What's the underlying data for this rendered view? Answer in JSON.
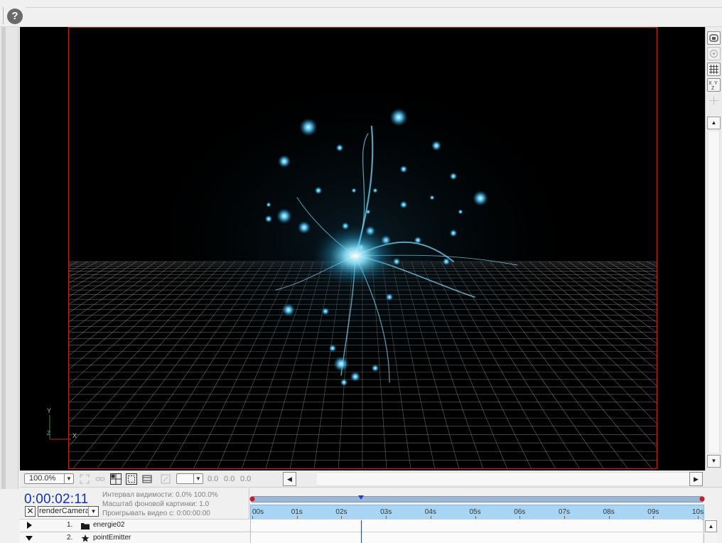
{
  "toolbar": {
    "help_label": "?"
  },
  "viewer": {
    "axis_y": "Y",
    "axis_z": "Z",
    "axis_x": "X",
    "colors": {
      "frame": "#cc1b1b",
      "grid": "#8a8a8a",
      "particles": "#5fd3ff"
    }
  },
  "viewer_bar": {
    "zoom_value": "100.0%",
    "coords": [
      "0.0",
      "0.0",
      "0.0"
    ],
    "scroll_left": "◀",
    "scroll_right": "▶"
  },
  "right_tools": {
    "icons": [
      "camera-orbit-icon",
      "target-icon",
      "grid-toggle-icon",
      "xyz-axis-icon",
      "light-icon"
    ],
    "scroll_up": "▲",
    "scroll_down": "▼"
  },
  "timeline": {
    "timecode": "0:00:02:11",
    "visibility_interval": "Интервал видимости: 0.0%  100.0%",
    "bg_scale": "Масштаб фоновой картинки: 1.0",
    "play_video_from": "Проигрывать видео с: 0:00:00:00",
    "camera_close": "✕",
    "camera_value": "renderCamera",
    "ruler_labels": [
      "00s",
      "01s",
      "02s",
      "03s",
      "04s",
      "05s",
      "06s",
      "07s",
      "08s",
      "09s",
      "10s"
    ],
    "playhead_seconds": 2.46,
    "duration_seconds": 10,
    "layers": [
      {
        "num": "1.",
        "name": "energie02",
        "icon": "folder-icon",
        "expanded": false
      },
      {
        "num": "2.",
        "name": "pointEmitter",
        "icon": "star-icon",
        "expanded": true
      }
    ],
    "scroll_up": "▲"
  }
}
